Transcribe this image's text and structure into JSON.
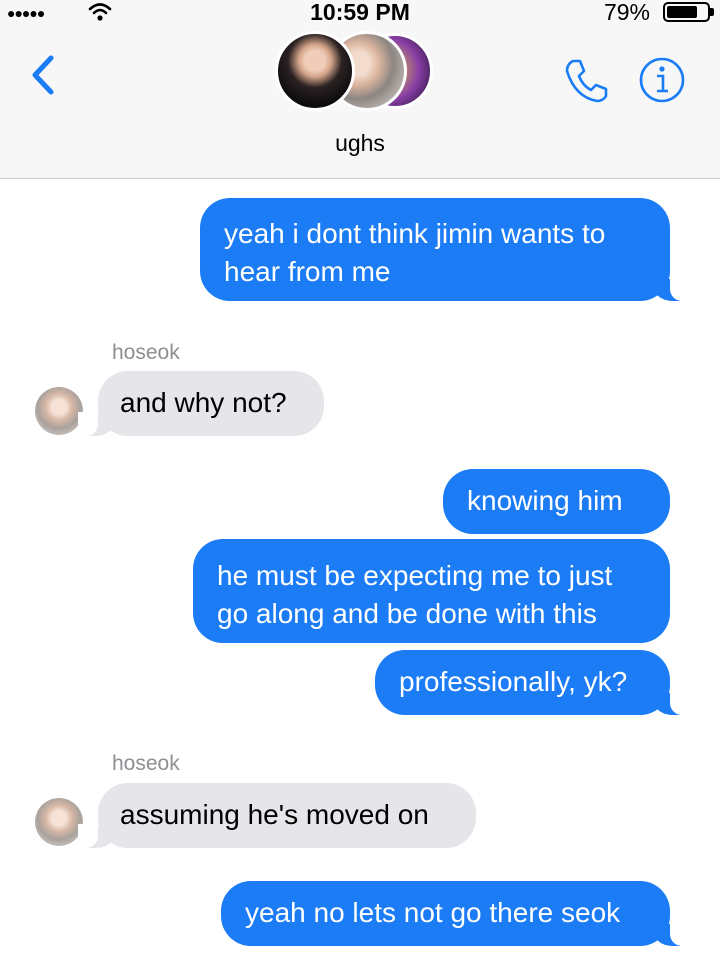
{
  "status_bar": {
    "signal": "●●●●●",
    "time": "10:59 PM",
    "battery_percent": "79%",
    "battery_level": 0.79
  },
  "header": {
    "group_name": "ughs",
    "icons": [
      "back-chevron-icon",
      "phone-icon",
      "info-icon"
    ]
  },
  "colors": {
    "sent_bubble": "#1c7cf6",
    "received_bubble": "#e5e5ea",
    "accent": "#1a7cf6"
  },
  "messages": [
    {
      "direction": "sent",
      "lines": [
        "yeah i dont think jimin wants to",
        "hear from me"
      ]
    },
    {
      "direction": "received",
      "sender": "hoseok",
      "text": "and why not?"
    },
    {
      "direction": "sent",
      "text": "knowing him"
    },
    {
      "direction": "sent",
      "lines": [
        "he must be expecting me to just",
        "go along and be done with this"
      ]
    },
    {
      "direction": "sent",
      "text": "professionally, yk?"
    },
    {
      "direction": "received",
      "sender": "hoseok",
      "text": "assuming he's moved on"
    },
    {
      "direction": "sent",
      "text": "yeah no lets not go there seok"
    }
  ]
}
